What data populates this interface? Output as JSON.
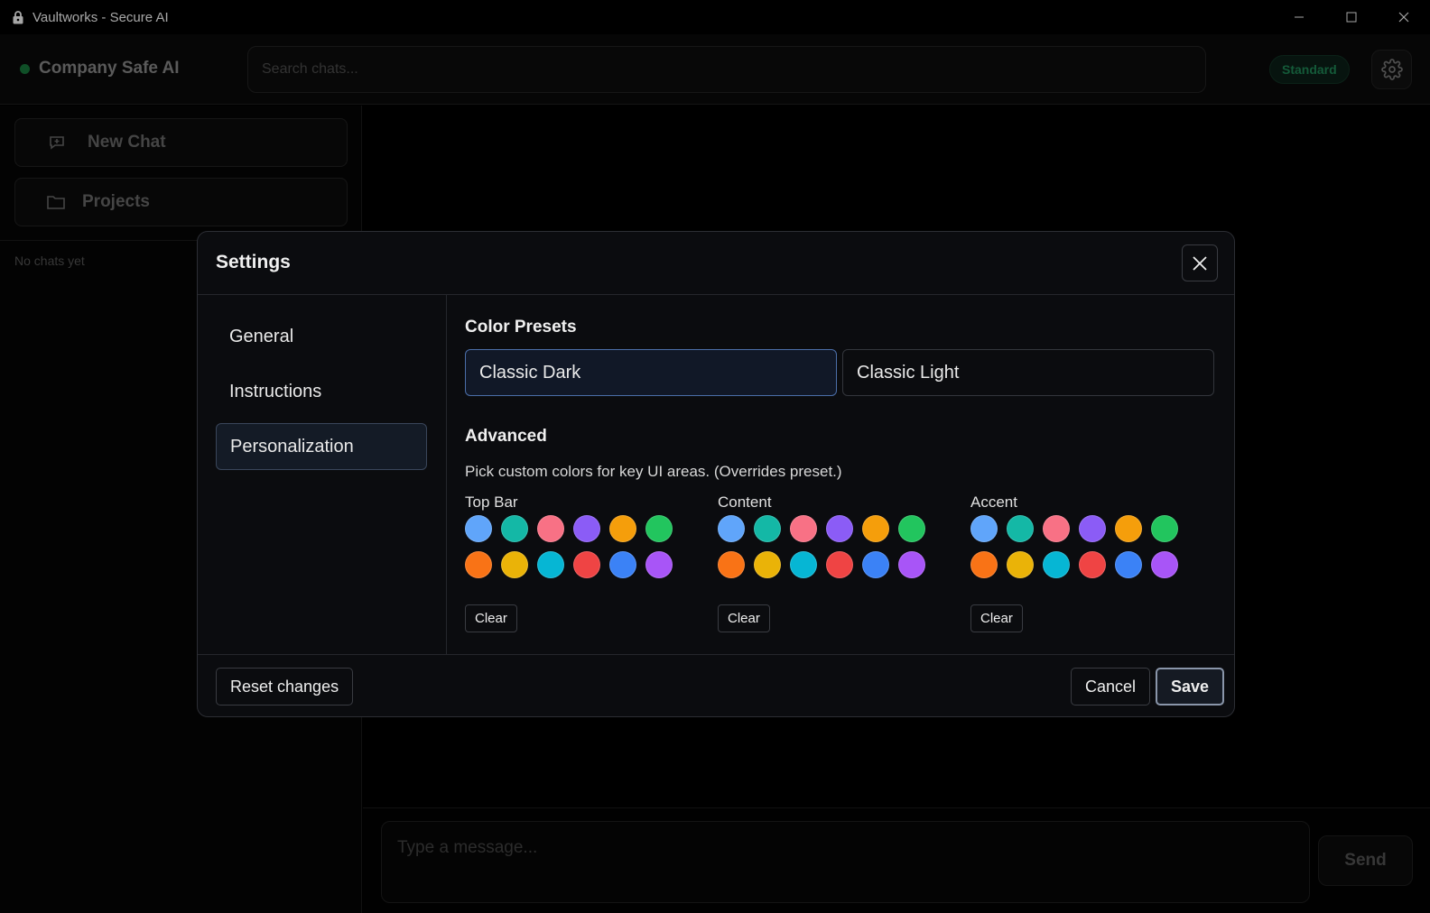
{
  "window": {
    "title": "Vaultworks - Secure AI"
  },
  "header": {
    "brand": "Company Safe AI",
    "search_placeholder": "Search chats...",
    "plan_badge": "Standard"
  },
  "sidebar": {
    "new_chat": "New Chat",
    "projects": "Projects",
    "empty_text": "No chats yet"
  },
  "composer": {
    "placeholder": "Type a message...",
    "send": "Send"
  },
  "settings": {
    "title": "Settings",
    "nav": [
      "General",
      "Instructions",
      "Personalization"
    ],
    "active_nav": "Personalization",
    "color_presets_heading": "Color Presets",
    "presets": [
      "Classic Dark",
      "Classic Light"
    ],
    "active_preset": "Classic Dark",
    "advanced_heading": "Advanced",
    "advanced_desc": "Pick custom colors for key UI areas. (Overrides preset.)",
    "groups": [
      {
        "label": "Top Bar",
        "clear": "Clear"
      },
      {
        "label": "Content",
        "clear": "Clear"
      },
      {
        "label": "Accent",
        "clear": "Clear"
      }
    ],
    "swatch_colors": [
      "#60a5fa",
      "#14b8a6",
      "#f87185",
      "#8b5cf6",
      "#f59e0b",
      "#22c55e",
      "#f97316",
      "#eab308",
      "#06b6d4",
      "#ef4444",
      "#3b82f6",
      "#a855f7"
    ],
    "footer": {
      "reset": "Reset changes",
      "cancel": "Cancel",
      "save": "Save"
    }
  }
}
